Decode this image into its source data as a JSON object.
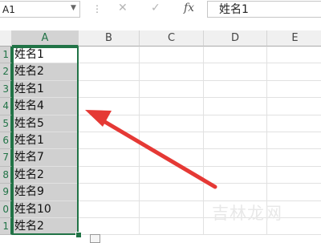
{
  "name_box": {
    "value": "A1"
  },
  "formula_bar": {
    "cancel_icon": "✕",
    "confirm_icon": "✓",
    "fx_label": "fx",
    "value": "姓名1"
  },
  "columns": [
    "A",
    "B",
    "C",
    "D",
    "E"
  ],
  "rows": [
    {
      "num": "1",
      "a": "姓名1"
    },
    {
      "num": "2",
      "a": "姓名2"
    },
    {
      "num": "3",
      "a": "姓名1"
    },
    {
      "num": "4",
      "a": "姓名4"
    },
    {
      "num": "5",
      "a": "姓名5"
    },
    {
      "num": "6",
      "a": "姓名1"
    },
    {
      "num": "7",
      "a": "姓名7"
    },
    {
      "num": "8",
      "a": "姓名2"
    },
    {
      "num": "9",
      "a": "姓名9"
    },
    {
      "num": "0",
      "a": "姓名10"
    },
    {
      "num": "1",
      "a": "姓名2"
    }
  ],
  "selected_column": "A",
  "watermark": {
    "text": "吉林龙网"
  },
  "colors": {
    "accent_green": "#217346",
    "arrow_red": "#e53935",
    "selection_fill": "#d0d0d0"
  }
}
